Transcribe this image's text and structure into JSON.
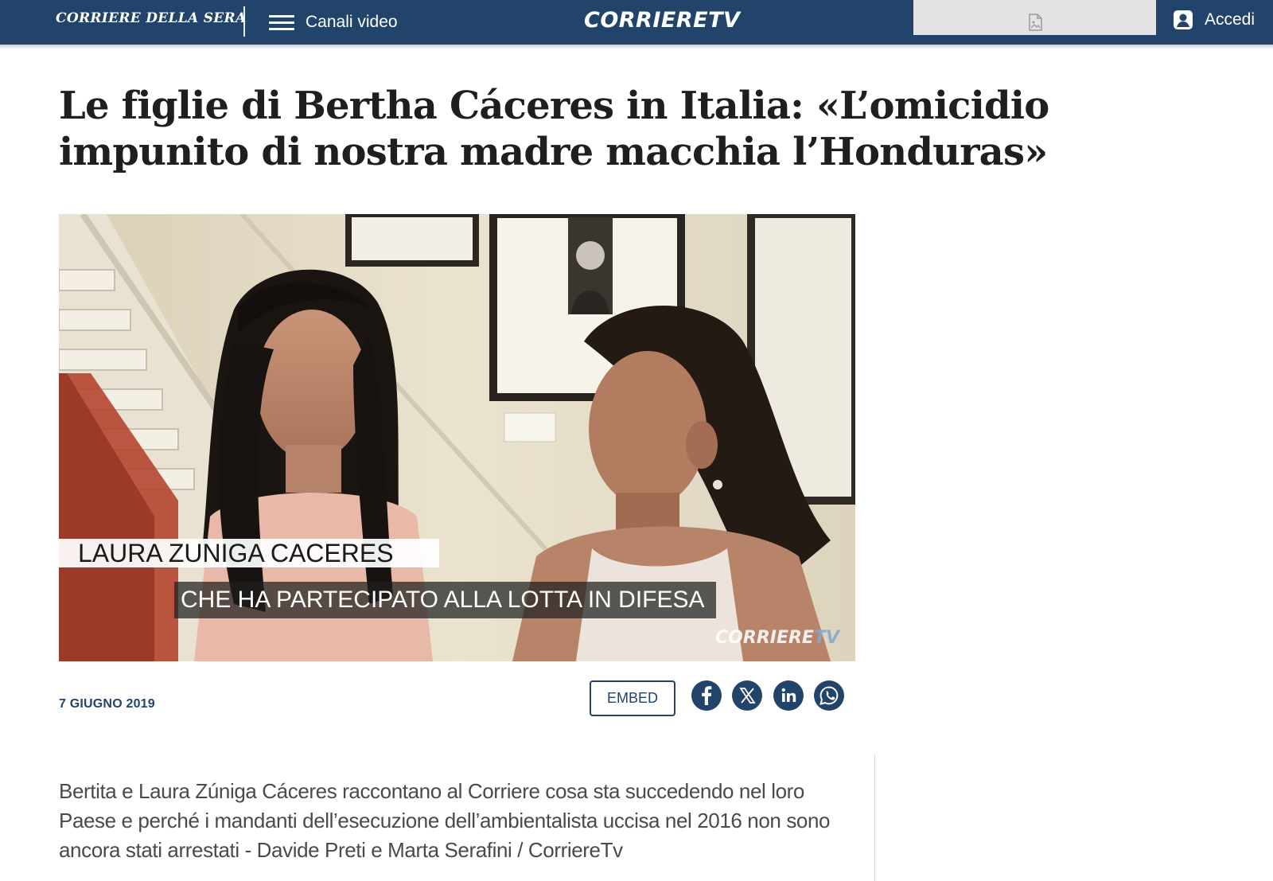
{
  "header": {
    "brand": "CORRIERE DELLA SERA",
    "menu_label": "Canali video",
    "tv_logo": "CORRIERETV",
    "login_label": "Accedi",
    "icons": {
      "menu": "hamburger-menu-icon",
      "ad": "broken-image-icon",
      "login": "user-account-icon"
    }
  },
  "article": {
    "title": "Le figlie di Bertha Cáceres in Italia: «L’omicidio impunito di nostra madre macchia l’Honduras»",
    "video": {
      "lower_third_name": "LAURA ZUNIGA CACERES",
      "lower_third_sub": "CHE HA PARTECIPATO ALLA LOTTA IN DIFESA",
      "watermark_part1": "CORRIERE",
      "watermark_part2": "TV"
    },
    "date": "7 GIUGNO 2019",
    "embed_label": "EMBED",
    "share": [
      "facebook-icon",
      "x-icon",
      "linkedin-icon",
      "whatsapp-icon"
    ],
    "summary": "Bertita e Laura Zúniga Cáceres raccontano al Corriere cosa sta succedendo nel loro Paese e perché i mandanti dell’esecuzione dell’ambientalista uccisa nel 2016 non sono ancora stati arrestati - Davide Preti e Marta Serafini / CorriereTv"
  },
  "colors": {
    "brand_blue": "#22446b",
    "background": "#ffffff",
    "title_text": "#1f1f1f",
    "summary_text": "#4a4a4a"
  }
}
